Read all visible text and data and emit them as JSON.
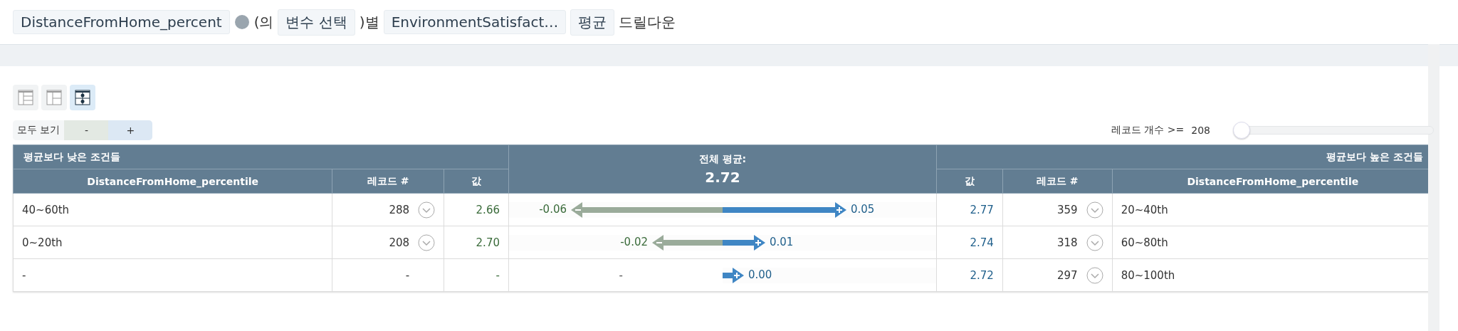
{
  "query_bar": {
    "field": "DistanceFromHome_percent",
    "connector": "(의",
    "variable": "변수 선택",
    "by": ")별",
    "target": "EnvironmentSatisfact…",
    "aggregate": "평균",
    "suffix": "드릴다운"
  },
  "view_buttons": [
    {
      "selected": false
    },
    {
      "selected": false
    },
    {
      "selected": true
    }
  ],
  "zoom_controls": {
    "label": "모두 보기",
    "minus": "-",
    "plus": "+"
  },
  "record_filter": {
    "label": "레코드 개수 >=",
    "value": "208",
    "level": 0
  },
  "table": {
    "lower_title": "평균보다 낮은 조건들",
    "higher_title": "평균보다 높은 조건들",
    "overall_label": "전체 평균:",
    "overall_value": "2.72",
    "left_columns": [
      "DistanceFromHome_percentile",
      "레코드 #",
      "값"
    ],
    "right_columns": [
      "값",
      "레코드 #",
      "DistanceFromHome_percentile"
    ],
    "rows": [
      {
        "left": {
          "condition": "40~60th",
          "records": "288",
          "expandable": true,
          "value": "2.66",
          "diff": "-0.06",
          "level": 0.71
        },
        "right": {
          "condition": "20~40th",
          "records": "359",
          "expandable": true,
          "value": "2.77",
          "diff": "0.05",
          "level": 0.58
        }
      },
      {
        "left": {
          "condition": "0~20th",
          "records": "208",
          "expandable": true,
          "value": "2.70",
          "diff": "-0.02",
          "level": 0.33
        },
        "right": {
          "condition": "60~80th",
          "records": "318",
          "expandable": true,
          "value": "2.74",
          "diff": "0.01",
          "level": 0.2
        }
      },
      {
        "left": {
          "condition": "-",
          "records": "-",
          "expandable": false,
          "value": "-",
          "diff": "-"
        },
        "right": {
          "condition": "80~100th",
          "records": "297",
          "expandable": true,
          "value": "2.72",
          "diff": "0.00",
          "level": 0.1
        }
      }
    ]
  }
}
